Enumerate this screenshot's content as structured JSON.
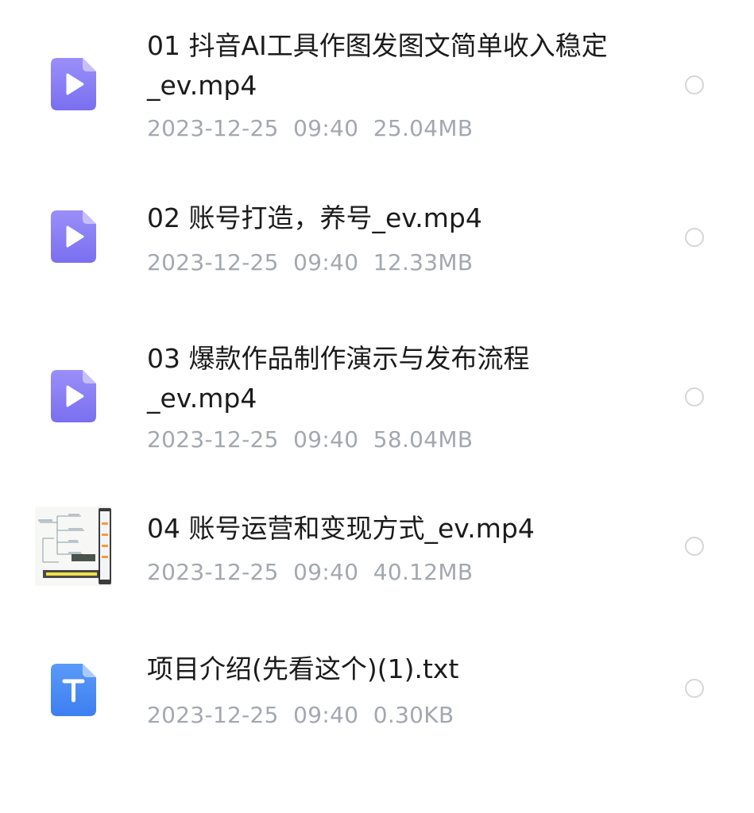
{
  "files": [
    {
      "name": "01 抖音AI工具作图发图文简单收入稳定_ev.mp4",
      "date": "2023-12-25",
      "time": "09:40",
      "size": "25.04MB",
      "icon": "video-file-icon"
    },
    {
      "name": "02 账号打造，养号_ev.mp4",
      "date": "2023-12-25",
      "time": "09:40",
      "size": "12.33MB",
      "icon": "video-file-icon"
    },
    {
      "name": "03 爆款作品制作演示与发布流程_ev.mp4",
      "date": "2023-12-25",
      "time": "09:40",
      "size": "58.04MB",
      "icon": "video-file-icon"
    },
    {
      "name": "04 账号运营和变现方式_ev.mp4",
      "date": "2023-12-25",
      "time": "09:40",
      "size": "40.12MB",
      "icon": "video-thumbnail"
    },
    {
      "name": "项目介绍(先看这个)(1).txt",
      "date": "2023-12-25",
      "time": "09:40",
      "size": "0.30KB",
      "icon": "text-file-icon"
    }
  ],
  "colors": {
    "video_icon": "#8a7ef5",
    "text_icon": "#4a8cf6",
    "meta_text": "#a3a8b0",
    "name_text": "#1b1b1b",
    "radio_border": "#d6d6d6"
  },
  "meta_separator": "  "
}
